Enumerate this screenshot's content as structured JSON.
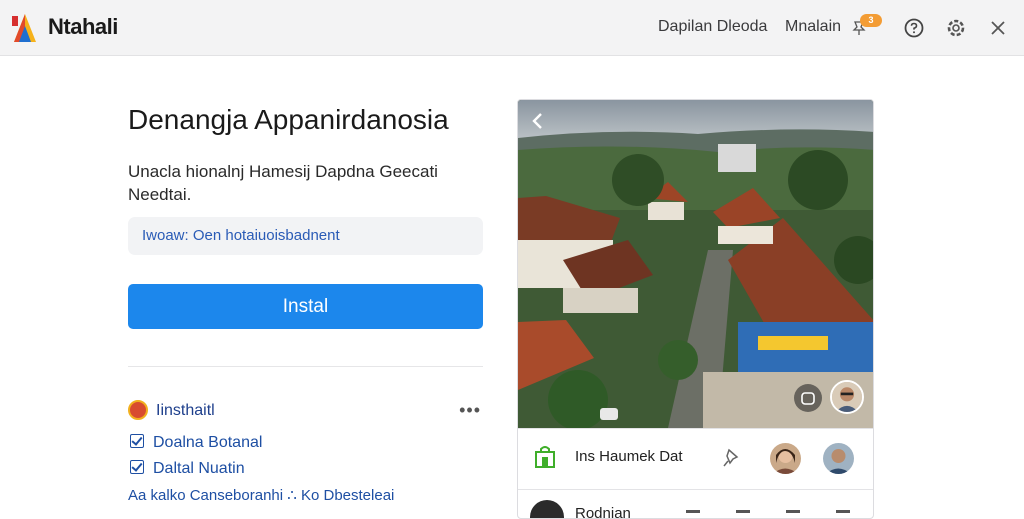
{
  "header": {
    "app_name": "Ntahali",
    "link_1": "Dapilan Dleoda",
    "link_2": "Mnalain",
    "badge": "3",
    "icons": [
      "help-icon",
      "settings-icon",
      "close-icon"
    ]
  },
  "main": {
    "title": "Denangja Appanirdanosia",
    "description": "Unacla hionalnj Hamesij Dapdna Geecati Needtai.",
    "info": "Iwoaw: Oen hotaiuoisbadnent",
    "install_label": "Instal",
    "publisher": {
      "name": "Iinsthaitl",
      "more": "•••"
    },
    "checks": [
      "Doalna Botanal",
      "Daltal Nuatin"
    ],
    "footer_link": "Aa kalko Canseboranhi ∴ Ko Dbesteleai"
  },
  "card": {
    "row_title": "Ins Haumek Dat",
    "row2_name": "Rodnian"
  },
  "colors": {
    "accent": "#1c87ec",
    "link": "#1e4fa3",
    "badge": "#f39c34",
    "bag": "#3fae2a"
  }
}
